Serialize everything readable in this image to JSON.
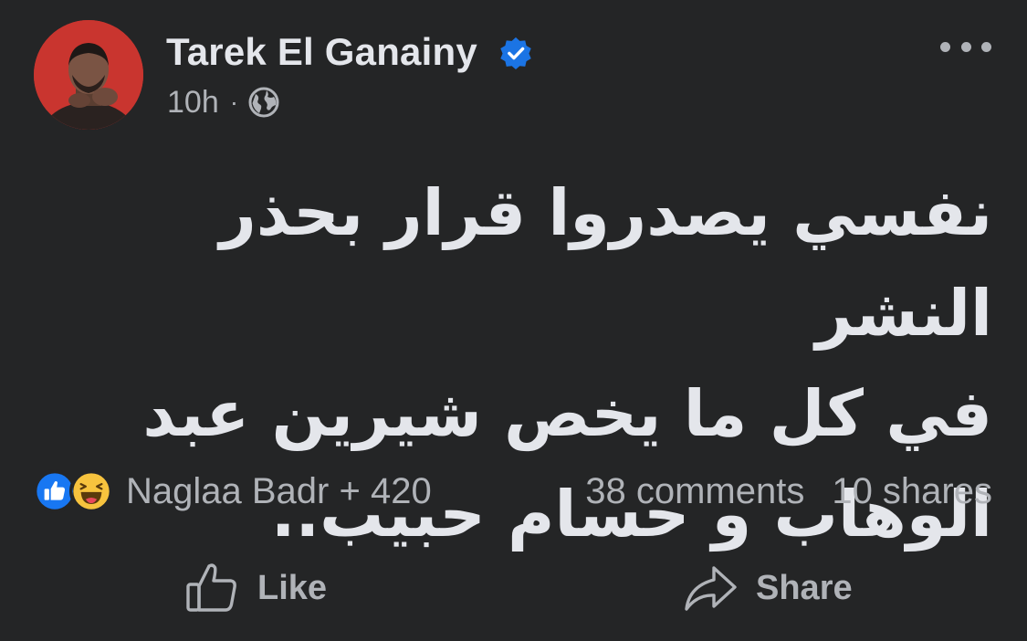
{
  "post": {
    "author": {
      "name": "Tarek El Ganainy",
      "verified": true,
      "avatar_icon": "profile-photo"
    },
    "timestamp": "10h",
    "separator": "·",
    "audience_icon": "globe-icon",
    "more_icon": "more-options-icon",
    "text_lines": [
      "نفسي يصدروا قرار بحذر النشر",
      "في كل ما يخص شيرين عبد",
      "الوهاب و حسام حبيب.."
    ]
  },
  "engagement": {
    "reaction_icons": [
      "like-reaction-icon",
      "haha-reaction-icon"
    ],
    "reactors": "Naglaa Badr + 420",
    "comments": "38 comments",
    "shares": "10 shares"
  },
  "actions": {
    "like_label": "Like",
    "share_label": "Share"
  },
  "colors": {
    "background": "#242526",
    "primary_text": "#e4e6eb",
    "secondary_text": "#b0b3b8",
    "verified_blue": "#1b74e4",
    "like_blue": "#1877f2",
    "haha_yellow": "#f7c33e"
  }
}
